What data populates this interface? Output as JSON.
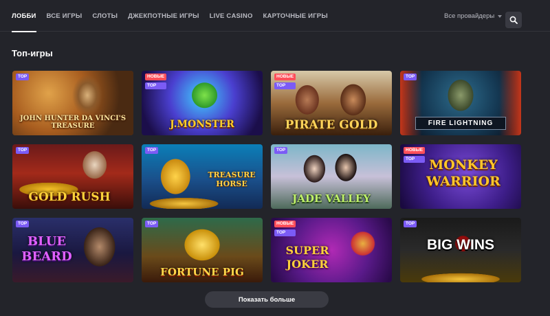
{
  "nav": {
    "tabs": [
      {
        "label": "ЛОББИ",
        "active": true
      },
      {
        "label": "ВСЕ ИГРЫ",
        "active": false
      },
      {
        "label": "СЛОТЫ",
        "active": false
      },
      {
        "label": "ДЖЕКПОТНЫЕ ИГРЫ",
        "active": false
      },
      {
        "label": "LIVE CASINO",
        "active": false
      },
      {
        "label": "КАРТОЧНЫЕ ИГРЫ",
        "active": false
      }
    ],
    "provider_select": "Все провайдеры",
    "search_icon": "search-icon"
  },
  "section": {
    "title": "Топ-игры"
  },
  "games": [
    {
      "title": "JOHN HUNTER DA VINCI'S TREASURE",
      "badges": [
        "TOP"
      ]
    },
    {
      "title": "J.MONSTER",
      "badges": [
        "НОВЫЕ",
        "TOP"
      ]
    },
    {
      "title": "PIRATE GOLD",
      "badges": [
        "НОВЫЕ",
        "TOP"
      ]
    },
    {
      "title": "FIRE LIGHTNING",
      "badges": [
        "TOP"
      ]
    },
    {
      "title": "GOLD RUSH",
      "badges": [
        "TOP"
      ]
    },
    {
      "title": "TREASURE HORSE",
      "badges": [
        "TOP"
      ]
    },
    {
      "title": "JADE VALLEY",
      "badges": [
        "TOP"
      ]
    },
    {
      "title": "MONKEY WARRIOR",
      "badges": [
        "НОВЫЕ",
        "TOP"
      ]
    },
    {
      "title": "BLUE BEARD",
      "badges": [
        "TOP"
      ]
    },
    {
      "title": "FORTUNE PIG",
      "badges": [
        "TOP"
      ]
    },
    {
      "title": "SUPER JOKER",
      "badges": [
        "НОВЫЕ",
        "TOP"
      ]
    },
    {
      "title": "BIG WINS",
      "badges": [
        "TOP"
      ]
    }
  ],
  "more_button": "Показать больше",
  "colors": {
    "background": "#23242a",
    "badge_top": "#7b5bf5",
    "badge_new": "#ff4f5a",
    "button": "#3a3b43"
  }
}
